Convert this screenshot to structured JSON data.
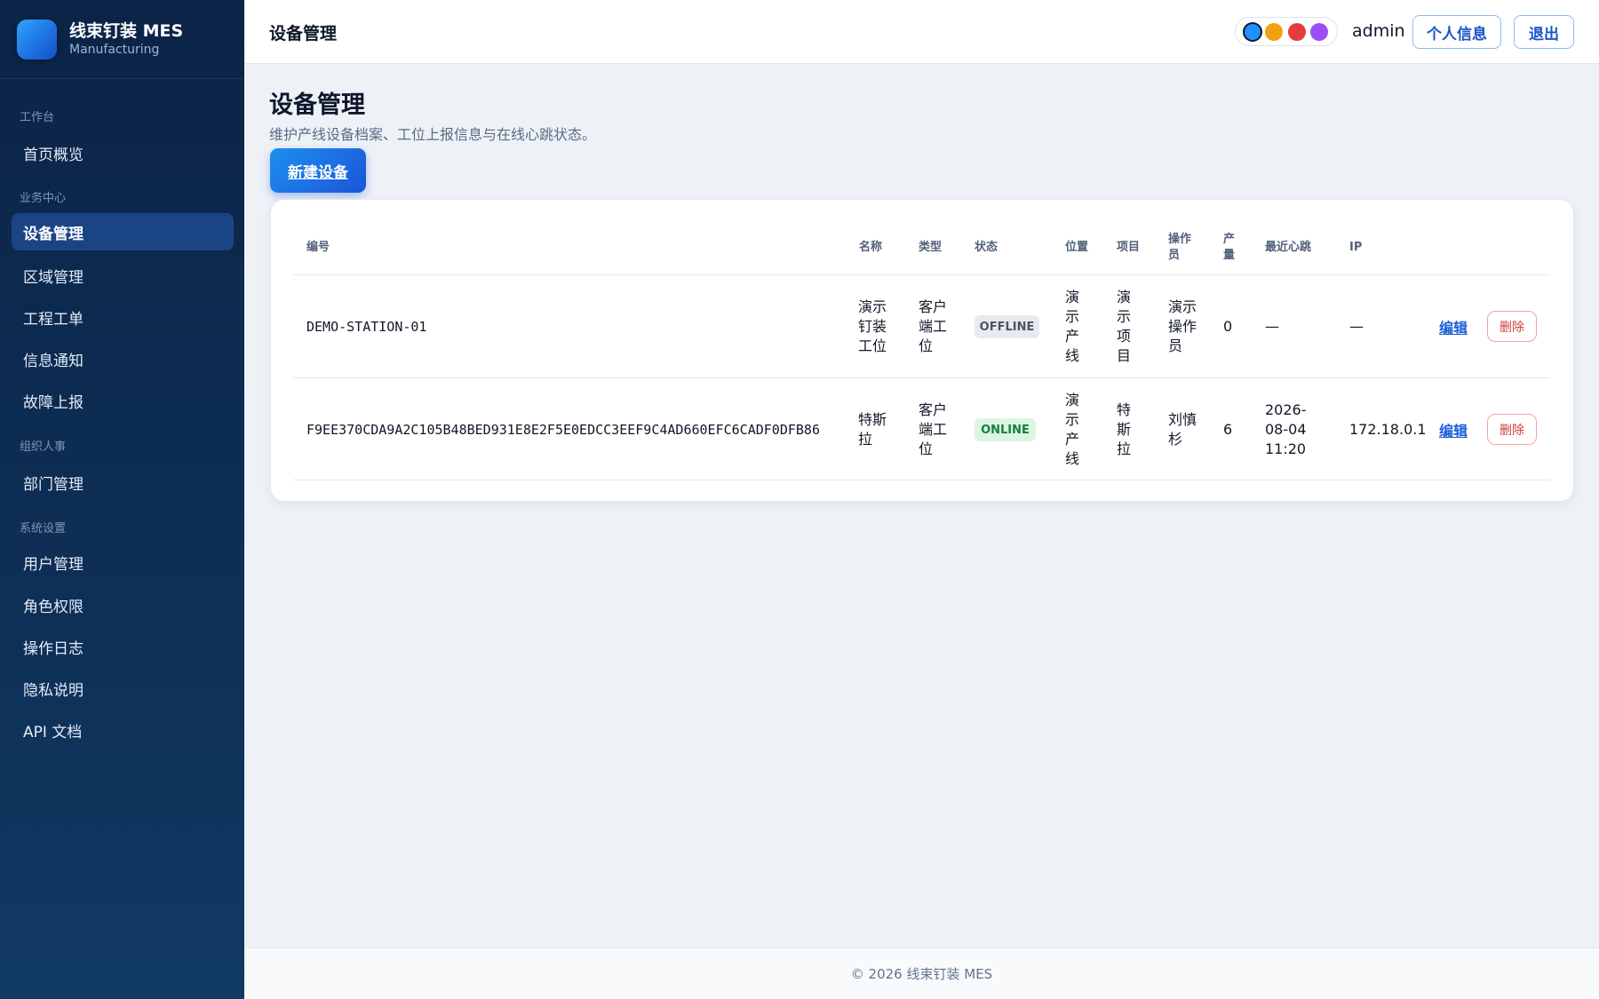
{
  "brand": {
    "name": "线束钉装 MES",
    "subtitle": "Manufacturing"
  },
  "sidebar": {
    "groups": [
      "工作台",
      "业务中心",
      "组织人事",
      "系统设置"
    ],
    "items": [
      {
        "label": "首页概览"
      },
      {
        "label": "设备管理",
        "active": true
      },
      {
        "label": "区域管理"
      },
      {
        "label": "工程工单"
      },
      {
        "label": "信息通知"
      },
      {
        "label": "故障上报"
      },
      {
        "label": "部门管理"
      },
      {
        "label": "用户管理"
      },
      {
        "label": "角色权限"
      },
      {
        "label": "操作日志"
      },
      {
        "label": "隐私说明"
      },
      {
        "label": "API 文档"
      }
    ]
  },
  "header": {
    "title": "设备管理",
    "theme_colors": [
      "#1e90ff",
      "#f0a20c",
      "#e43b3b",
      "#9b4ff0"
    ],
    "user": "admin",
    "profile_label": "个人信息",
    "logout_label": "退出"
  },
  "main": {
    "title": "设备管理",
    "description": "维护产线设备档案、工位上报信息与在线心跳状态。",
    "new_button": "新建设备",
    "table": {
      "columns": [
        "编号",
        "名称",
        "类型",
        "状态",
        "位置",
        "项目",
        "操作员",
        "产量",
        "最近心跳",
        "IP"
      ],
      "rows": [
        {
          "code": "DEMO-STATION-01",
          "name": "演示钉装工位",
          "type": "客户端工位",
          "status": "OFFLINE",
          "location": "演示产线",
          "project": "演示项目",
          "operator": "演示操作员",
          "output": "0",
          "heartbeat": "—",
          "ip": "—",
          "edit": "编辑",
          "delete": "删除"
        },
        {
          "code": "F9EE370CDA9A2C105B48BED931E8E2F5E0EDCC3EEF9C4AD660EFC6CADF0DFB86",
          "name": "特斯拉",
          "type": "客户端工位",
          "status": "ONLINE",
          "location": "演示产线",
          "project": "特斯拉",
          "operator": "刘慎杉",
          "output": "6",
          "heartbeat": "2026-08-04 11:20",
          "ip": "172.18.0.1",
          "edit": "编辑",
          "delete": "删除"
        }
      ]
    }
  },
  "footer": {
    "text": "© 2026 线束钉装 MES"
  },
  "colors": {
    "sidebar_bg": "#0b2447",
    "accent": "#1a55d8",
    "online": "#15803d",
    "offline": "#4b5563",
    "danger": "#d23b3b"
  }
}
